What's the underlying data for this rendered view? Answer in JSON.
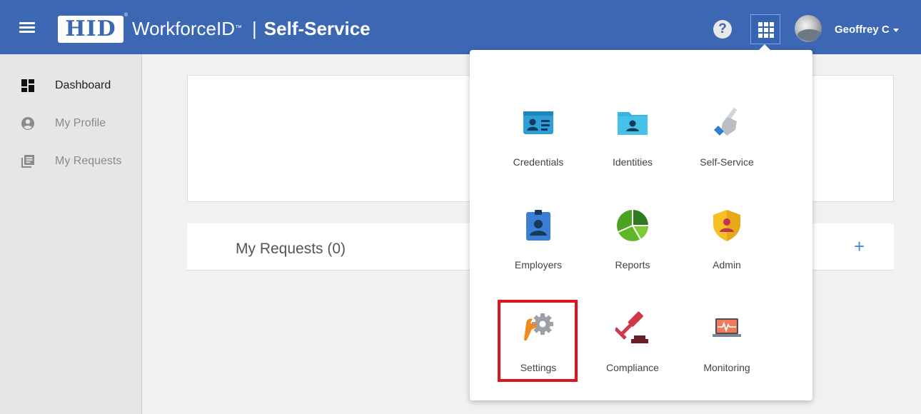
{
  "header": {
    "logo_text": "HID",
    "logo_reg": "®",
    "brand_name": "WorkforceID",
    "brand_tm": "™",
    "brand_separator": "|",
    "brand_subtitle": "Self-Service",
    "help_glyph": "?",
    "user_name": "Geoffrey C",
    "icons": {
      "menu": "hamburger-icon",
      "help": "help-icon",
      "apps": "apps-grid-icon",
      "user": "avatar"
    },
    "colors": {
      "header_bg": "#3b67b3"
    }
  },
  "sidebar": {
    "items": [
      {
        "label": "Dashboard",
        "icon": "dashboard-icon",
        "active": true
      },
      {
        "label": "My Profile",
        "icon": "account-circle-icon",
        "active": false
      },
      {
        "label": "My Requests",
        "icon": "library-books-icon",
        "active": false
      }
    ]
  },
  "main": {
    "requests_title": "My Requests (0)",
    "add_glyph": "+"
  },
  "apps_menu": {
    "tiles": [
      {
        "label": "Credentials",
        "icon": "id-card-icon"
      },
      {
        "label": "Identities",
        "icon": "folder-user-icon"
      },
      {
        "label": "Self-Service",
        "icon": "pointing-hand-icon"
      },
      {
        "label": "Employers",
        "icon": "badge-icon"
      },
      {
        "label": "Reports",
        "icon": "pie-chart-icon"
      },
      {
        "label": "Admin",
        "icon": "shield-user-icon"
      },
      {
        "label": "Settings",
        "icon": "wrench-gear-icon",
        "highlighted": true
      },
      {
        "label": "Compliance",
        "icon": "gavel-icon"
      },
      {
        "label": "Monitoring",
        "icon": "laptop-pulse-icon"
      }
    ],
    "highlight_color": "#e0131d"
  }
}
